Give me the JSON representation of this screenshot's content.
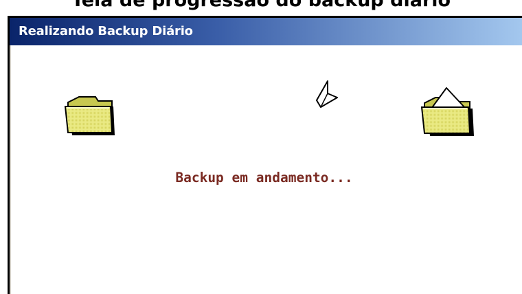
{
  "caption": "Tela de progressão do backup diário",
  "window": {
    "title": "Realizando Backup Diário"
  },
  "status": {
    "message": "Backup em andamento..."
  },
  "icons": {
    "source_folder": "folder-icon",
    "destination_folder": "open-folder-icon",
    "flying_document": "document-icon"
  },
  "colors": {
    "titlebar_start": "#0a246a",
    "titlebar_end": "#a6caf0",
    "status_text": "#7a2a22",
    "folder_fill": "#e8e87c"
  }
}
